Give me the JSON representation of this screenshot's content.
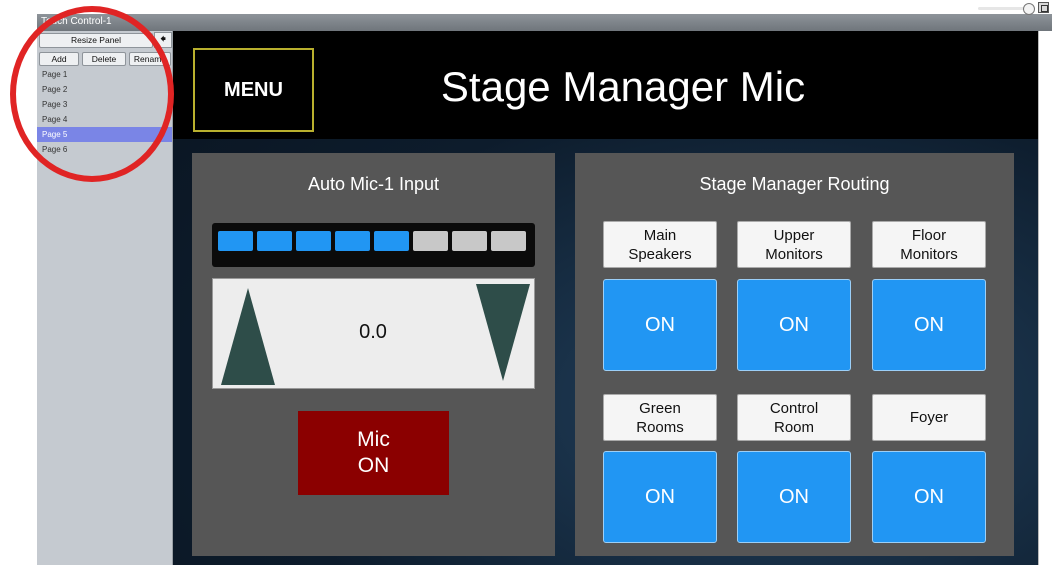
{
  "window": {
    "title": "Touch Control-1"
  },
  "sidebar": {
    "resize_label": "Resize Panel",
    "add_label": "Add",
    "delete_label": "Delete",
    "rename_label": "Rename",
    "pages": [
      "Page 1",
      "Page 2",
      "Page 3",
      "Page 4",
      "Page 5",
      "Page 6"
    ],
    "selected_page": "Page 5"
  },
  "header": {
    "menu_label": "MENU",
    "title": "Stage Manager Mic"
  },
  "input_panel": {
    "title": "Auto Mic-1 Input",
    "meter": {
      "segments_total": 8,
      "segments_lit": 5,
      "lit_color": "#2196f3",
      "unlit_color": "#c8c8c8"
    },
    "fader_value": "0.0",
    "mic_button": {
      "line1": "Mic",
      "line2": "ON",
      "color": "#8b0000"
    }
  },
  "routing_panel": {
    "title": "Stage Manager Routing",
    "destinations": [
      {
        "line1": "Main",
        "line2": "Speakers",
        "state": "ON"
      },
      {
        "line1": "Upper",
        "line2": "Monitors",
        "state": "ON"
      },
      {
        "line1": "Floor",
        "line2": "Monitors",
        "state": "ON"
      },
      {
        "line1": "Green",
        "line2": "Rooms",
        "state": "ON"
      },
      {
        "line1": "Control",
        "line2": "Room",
        "state": "ON"
      },
      {
        "line1": "Foyer",
        "line2": "",
        "state": "ON"
      }
    ],
    "on_color": "#2196f3"
  }
}
